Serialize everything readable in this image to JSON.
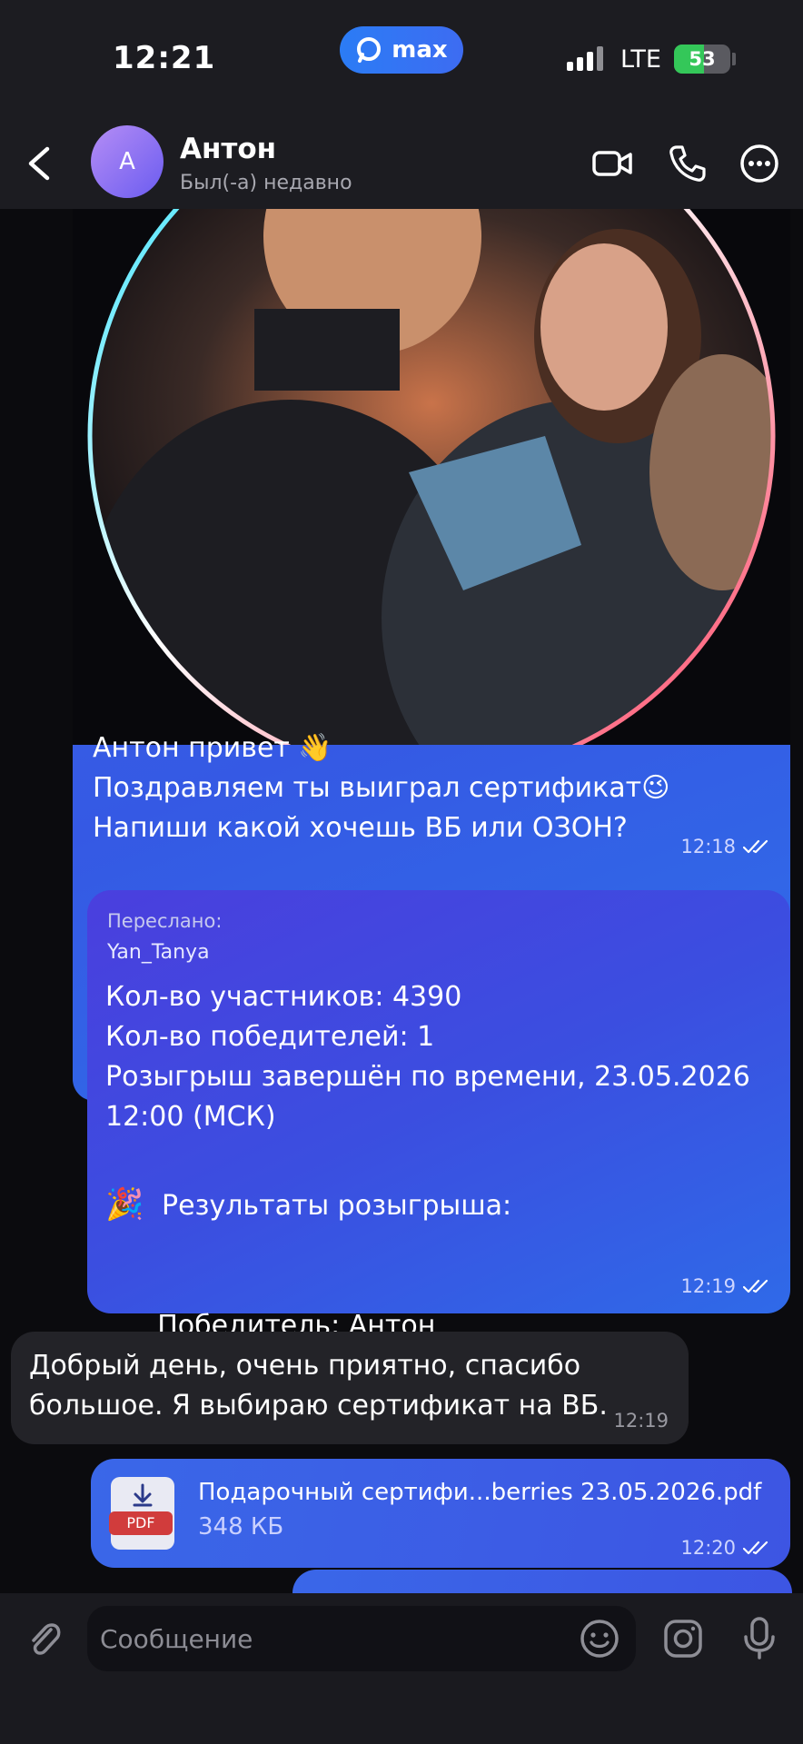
{
  "status_bar": {
    "time": "12:21",
    "app_badge": "max",
    "network": "LTE",
    "battery": "53",
    "battery_level": 0.53
  },
  "header": {
    "avatar_letter": "А",
    "name": "Антон",
    "status": "Был(-а) недавно",
    "icons": [
      "back-chevron-icon",
      "video-call-icon",
      "phone-icon",
      "more-icon"
    ]
  },
  "messages": {
    "photo_message": {
      "text": "Антон привет 👋\nПоздравляем ты выиграл сертификат😉\nНапиши какой хочешь ВБ или ОЗОН?",
      "time": "12:18"
    },
    "forwarded": {
      "label": "Переслано:",
      "from": "Yan_Tanya",
      "body": "Кол-во участников: 4390\nКол-во победителей: 1\nРозыгрыш завершён по времени, 23.05.2026\n12:00 (МСК)",
      "results_emoji": "🎉",
      "results_label": "Результаты розыгрыша:",
      "winner_label": "Победитель: ",
      "winner_name": "Антон",
      "time": "12:19"
    },
    "incoming": {
      "text": "Добрый день, очень приятно, спасибо\nбольшое. Я выбираю сертификат на ВБ.",
      "time": "12:19"
    },
    "file": {
      "icon_tag": "PDF",
      "name": "Подарочный сертифи...berries 23.05.2026.pdf",
      "size": "348 КБ",
      "time": "12:20"
    }
  },
  "input": {
    "placeholder": "Сообщение"
  },
  "colors": {
    "outgoing_bubble": "#3a67e8",
    "forwarded_bubble": "#4a3fde",
    "incoming_bubble": "#232328",
    "background": "#0b0b0e"
  }
}
